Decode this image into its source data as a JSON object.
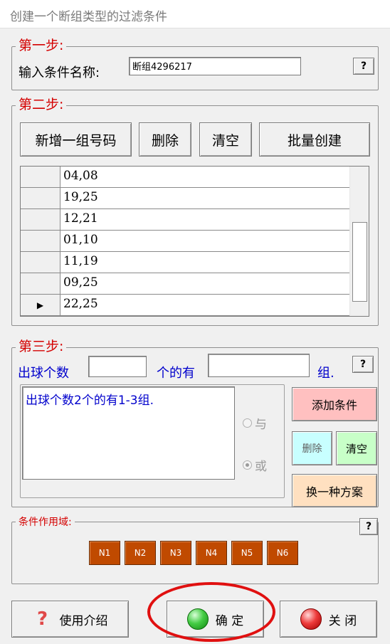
{
  "window": {
    "title": "创建一个断组类型的过滤条件"
  },
  "step1": {
    "legend": "第一步:",
    "label": "输入条件名称:",
    "name_value": "断组4296217",
    "help_label": "?"
  },
  "step2": {
    "legend": "第二步:",
    "buttons": {
      "add": "新增一组号码",
      "delete": "删除",
      "clear": "清空",
      "batch": "批量创建"
    },
    "rows": [
      "04,08",
      "19,25",
      "12,21",
      "01,10",
      "11,19",
      "09,25",
      "22,25"
    ],
    "current_row_marker": "▶"
  },
  "step3": {
    "legend": "第三步:",
    "count_label": "出球个数",
    "count_value": "",
    "middle_label": "个的有",
    "group_value": "",
    "unit_label": "组.",
    "help_label": "?",
    "condition_text": "出球个数2个的有1-3组.",
    "radio_and": "与",
    "radio_or": "或",
    "selected_logic": "或",
    "buttons": {
      "add_condition": "添加条件",
      "delete": "删除",
      "clear": "清空",
      "switch": "换一种方案"
    }
  },
  "scope": {
    "legend": "条件作用域:",
    "help_label": "?",
    "positions": [
      "N1",
      "N2",
      "N3",
      "N4",
      "N5",
      "N6"
    ]
  },
  "footer": {
    "intro": "使用介绍",
    "ok": "确 定",
    "close": "关 闭"
  },
  "colors": {
    "legend_red": "#d40000",
    "label_blue": "#0000cc",
    "add_condition_bg": "#ffc0c0",
    "delete_bg": "#c8ffff",
    "clear_bg": "#c8ffc8",
    "switch_bg": "#ffe0c0",
    "position_bg": "#c04a00",
    "highlight_red": "#e01010"
  },
  "icons": {
    "intro": "question-mark-icon",
    "ok": "green-orb-icon",
    "close": "red-orb-icon",
    "row_pointer": "row-pointer-icon"
  }
}
